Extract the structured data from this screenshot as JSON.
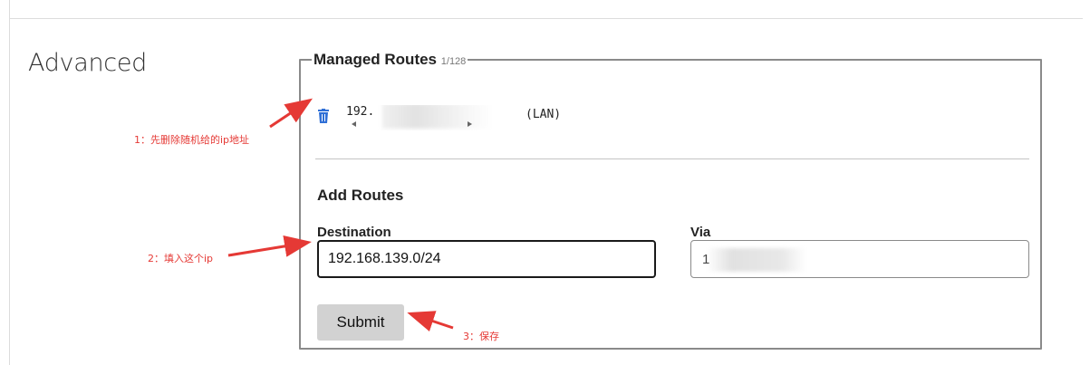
{
  "section": {
    "title": "Advanced"
  },
  "managed_routes": {
    "title": "Managed Routes",
    "count": "1/128",
    "routes": [
      {
        "ip_visible": "192.",
        "type_label": "(LAN)"
      }
    ]
  },
  "add_routes": {
    "title": "Add Routes",
    "destination_label": "Destination",
    "destination_value": "192.168.139.0/24",
    "via_label": "Via",
    "via_value_visible": "1",
    "submit_label": "Submit"
  },
  "annotations": {
    "step1": "1：先删除随机给的ip地址",
    "step2": "2：填入这个ip",
    "step3": "3：保存"
  },
  "colors": {
    "annotation_red": "#e53935",
    "trash_icon_blue": "#2f6fd6",
    "submit_bg": "#d2d2d2"
  }
}
